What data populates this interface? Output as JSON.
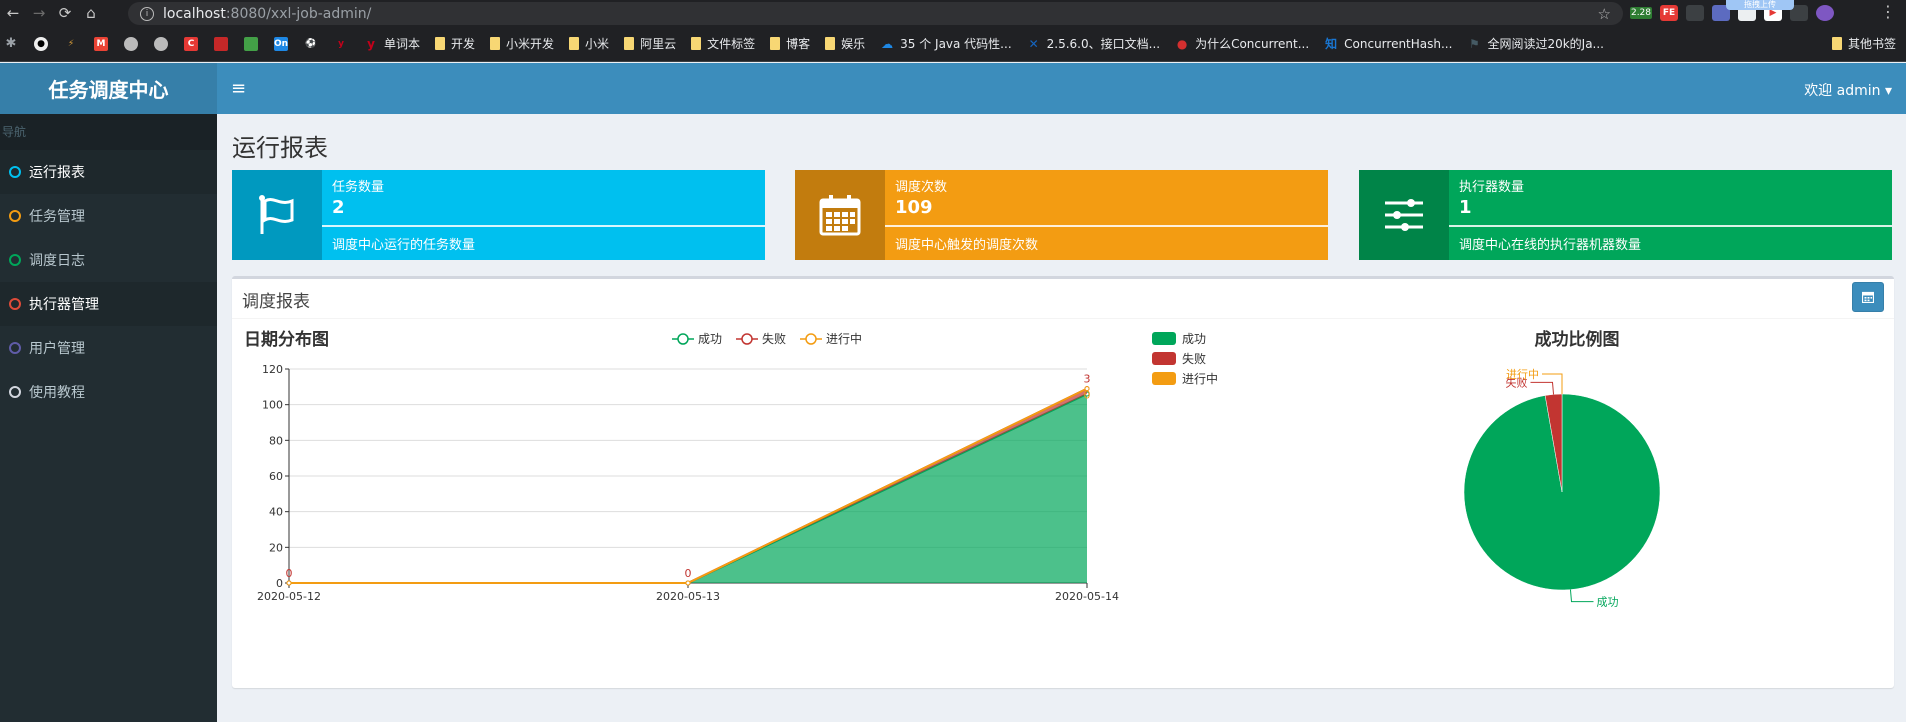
{
  "browser": {
    "url_host": "localhost",
    "url_rest": ":8080/xxl-job-admin/",
    "ext_badge": "2.28",
    "ext_fe": "FE",
    "ext_popup": "拖拽上传",
    "bookmarks": [
      {
        "label": "单词本",
        "type": "icon",
        "icon_color": "#c4001a",
        "glyph": "y"
      },
      {
        "label": "开发",
        "type": "folder"
      },
      {
        "label": "小米开发",
        "type": "folder"
      },
      {
        "label": "小米",
        "type": "folder"
      },
      {
        "label": "阿里云",
        "type": "folder"
      },
      {
        "label": "文件标签",
        "type": "folder"
      },
      {
        "label": "博客",
        "type": "folder"
      },
      {
        "label": "娱乐",
        "type": "folder"
      },
      {
        "label": "35 个 Java 代码性...",
        "type": "icon",
        "icon_color": "#1e88e5",
        "glyph": "☁"
      },
      {
        "label": "2.5.6.0、接口文档...",
        "type": "icon",
        "icon_color": "#1565c0",
        "glyph": "✕"
      },
      {
        "label": "为什么Concurrent...",
        "type": "icon",
        "icon_color": "#d32f2f",
        "glyph": "●"
      },
      {
        "label": "ConcurrentHash...",
        "type": "icon",
        "icon_color": "#1976d2",
        "glyph": "知"
      },
      {
        "label": "全网阅读过20k的Ja...",
        "type": "icon",
        "icon_color": "#455a64",
        "glyph": "⚑"
      }
    ],
    "other_bookmarks": "其他书签"
  },
  "app": {
    "logo": "任务调度中心",
    "nav_header": "导航",
    "nav": [
      {
        "label": "运行报表",
        "color": "#00c0ef",
        "active": true
      },
      {
        "label": "任务管理",
        "color": "#f39c12",
        "active": false
      },
      {
        "label": "调度日志",
        "color": "#00a65a",
        "active": false
      },
      {
        "label": "执行器管理",
        "color": "#dd4b39",
        "active": false,
        "hover": true
      },
      {
        "label": "用户管理",
        "color": "#605ca8",
        "active": false
      },
      {
        "label": "使用教程",
        "color": "#d2d6de",
        "active": false
      }
    ],
    "welcome": "欢迎 admin"
  },
  "page": {
    "title": "运行报表",
    "cards": [
      {
        "label": "任务数量",
        "value": "2",
        "desc": "调度中心运行的任务数量",
        "color": "#00c0ef",
        "icon": "flag-icon"
      },
      {
        "label": "调度次数",
        "value": "109",
        "desc": "调度中心触发的调度次数",
        "color": "#f39c12",
        "icon": "calendar-icon"
      },
      {
        "label": "执行器数量",
        "value": "1",
        "desc": "调度中心在线的执行器机器数量",
        "color": "#00a65a",
        "icon": "sliders-icon"
      }
    ],
    "report_title": "调度报表"
  },
  "chart_data": [
    {
      "type": "area",
      "title": "日期分布图",
      "x": [
        "2020-05-12",
        "2020-05-13",
        "2020-05-14"
      ],
      "ylim": [
        0,
        120
      ],
      "yticks": [
        0,
        20,
        40,
        60,
        80,
        100,
        120
      ],
      "legend": [
        "成功",
        "失败",
        "进行中"
      ],
      "legend_placement": "top-center",
      "series": [
        {
          "name": "成功",
          "values": [
            0,
            0,
            106
          ],
          "color": "#00a65a"
        },
        {
          "name": "失败",
          "values": [
            0,
            0,
            3
          ],
          "color": "#c23531"
        },
        {
          "name": "进行中",
          "values": [
            0,
            0,
            0
          ],
          "color": "#f39c12"
        }
      ],
      "data_labels": [
        {
          "x": "2020-05-12",
          "text": "0"
        },
        {
          "x": "2020-05-13",
          "text": "0"
        },
        {
          "x": "2020-05-14",
          "text": "3"
        },
        {
          "x": "2020-05-14",
          "text": "0"
        }
      ]
    },
    {
      "type": "pie",
      "title": "成功比例图",
      "legend_placement": "left",
      "slices": [
        {
          "name": "成功",
          "value": 106,
          "color": "#00a65a"
        },
        {
          "name": "失败",
          "value": 3,
          "color": "#c23531"
        },
        {
          "name": "进行中",
          "value": 0,
          "color": "#f39c12"
        }
      ]
    }
  ]
}
